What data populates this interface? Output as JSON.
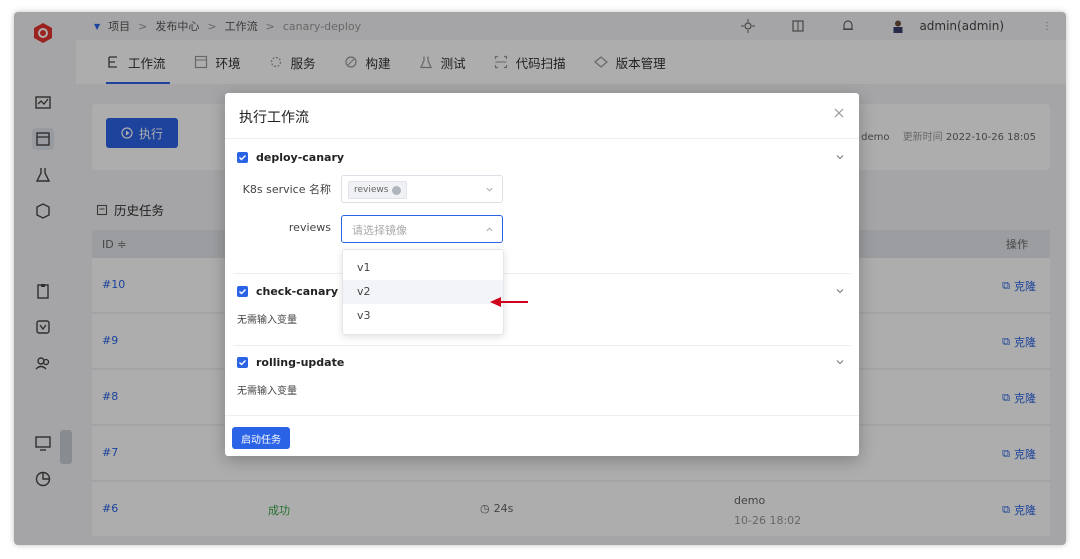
{
  "breadcrumb": [
    "项目",
    "发布中心",
    "工作流",
    "canary-deploy"
  ],
  "user": {
    "name": "admin(admin)"
  },
  "tabs": [
    {
      "label": "工作流",
      "icon": "workflow-icon"
    },
    {
      "label": "环境",
      "icon": "environment-icon"
    },
    {
      "label": "服务",
      "icon": "service-icon"
    },
    {
      "label": "构建",
      "icon": "build-icon"
    },
    {
      "label": "测试",
      "icon": "test-icon"
    },
    {
      "label": "代码扫描",
      "icon": "code-scan-icon"
    },
    {
      "label": "版本管理",
      "icon": "version-icon"
    }
  ],
  "run_card": {
    "exec_label": "执行",
    "meta_creator_fragment": ", demo",
    "meta_updated_label": "更新时间",
    "meta_updated_value": "2022-10-26 18:05"
  },
  "history": {
    "title": "历史任务",
    "col_id": "ID ≑",
    "col_op": "操作",
    "clone_label": "克隆",
    "rows": [
      {
        "id": "#10"
      },
      {
        "id": "#9"
      },
      {
        "id": "#8"
      },
      {
        "id": "#7"
      },
      {
        "id": "#6",
        "status": "成功",
        "duration": "24s",
        "creator": "demo",
        "time": "10-26 18:02"
      }
    ]
  },
  "modal": {
    "title": "执行工作流",
    "jobs": [
      {
        "name": "deploy-canary"
      },
      {
        "name": "check-canary",
        "note": "无需输入变量"
      },
      {
        "name": "rolling-update",
        "note": "无需输入变量"
      }
    ],
    "k8s_label": "K8s service 名称",
    "k8s_tag": "reviews",
    "reviews_label": "reviews",
    "image_placeholder": "请选择镜像",
    "dropdown_options": [
      "v1",
      "v2",
      "v3"
    ],
    "start_label": "启动任务"
  },
  "colors": {
    "accent": "#2b63e6",
    "success": "#3aa64a",
    "arrow": "#d0021b"
  }
}
